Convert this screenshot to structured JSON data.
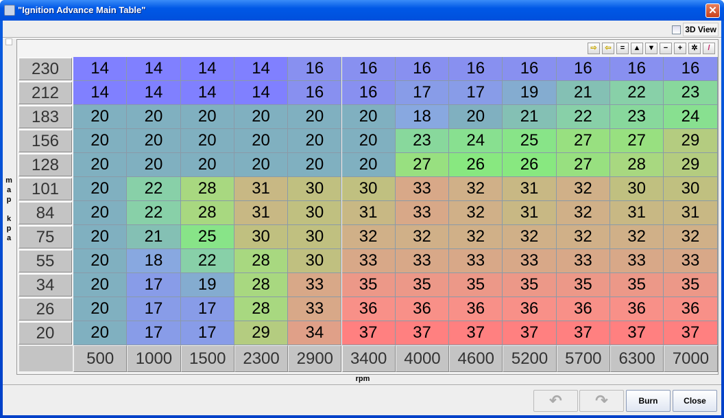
{
  "window": {
    "title": "\"Ignition Advance Main Table\"",
    "close_glyph": "✕"
  },
  "view3d_label": "3D View",
  "toolbar": [
    {
      "name": "shift-right",
      "glyph": "⇨"
    },
    {
      "name": "shift-left",
      "glyph": "⇦"
    },
    {
      "name": "set-equal",
      "glyph": "="
    },
    {
      "name": "increase",
      "glyph": "▲"
    },
    {
      "name": "decrease",
      "glyph": "▼"
    },
    {
      "name": "subtract",
      "glyph": "−"
    },
    {
      "name": "add",
      "glyph": "+"
    },
    {
      "name": "multiply",
      "glyph": "✲"
    },
    {
      "name": "paint",
      "glyph": "/"
    }
  ],
  "y_axis": {
    "label": "m\na\np\n\nk\np\na",
    "values": [
      "230",
      "212",
      "183",
      "156",
      "128",
      "101",
      "84",
      "75",
      "55",
      "34",
      "26",
      "20"
    ]
  },
  "x_axis": {
    "label": "rpm",
    "values": [
      "500",
      "1000",
      "1500",
      "2300",
      "2900",
      "3400",
      "4000",
      "4600",
      "5200",
      "5700",
      "6300",
      "7000"
    ]
  },
  "table": [
    [
      14,
      14,
      14,
      14,
      16,
      16,
      16,
      16,
      16,
      16,
      16,
      16
    ],
    [
      14,
      14,
      14,
      14,
      16,
      16,
      17,
      17,
      19,
      21,
      22,
      23
    ],
    [
      20,
      20,
      20,
      20,
      20,
      20,
      18,
      20,
      21,
      22,
      23,
      24
    ],
    [
      20,
      20,
      20,
      20,
      20,
      20,
      23,
      24,
      25,
      27,
      27,
      29
    ],
    [
      20,
      20,
      20,
      20,
      20,
      20,
      27,
      26,
      26,
      27,
      28,
      29
    ],
    [
      20,
      22,
      28,
      31,
      30,
      30,
      33,
      32,
      31,
      32,
      30,
      30
    ],
    [
      20,
      22,
      28,
      31,
      30,
      31,
      33,
      32,
      31,
      32,
      31,
      31
    ],
    [
      20,
      21,
      25,
      30,
      30,
      32,
      32,
      32,
      32,
      32,
      32,
      32
    ],
    [
      20,
      18,
      22,
      28,
      30,
      33,
      33,
      33,
      33,
      33,
      33,
      33
    ],
    [
      20,
      17,
      19,
      28,
      33,
      35,
      35,
      35,
      35,
      35,
      35,
      35
    ],
    [
      20,
      17,
      17,
      28,
      33,
      36,
      36,
      36,
      36,
      36,
      36,
      36
    ],
    [
      20,
      17,
      17,
      29,
      34,
      37,
      37,
      37,
      37,
      37,
      37,
      37
    ]
  ],
  "color_stops": [
    [
      14,
      "#8080ff"
    ],
    [
      16,
      "#8890f0"
    ],
    [
      18,
      "#88a8e0"
    ],
    [
      20,
      "#80b0c0"
    ],
    [
      22,
      "#88d0a8"
    ],
    [
      24,
      "#88e090"
    ],
    [
      26,
      "#88e880"
    ],
    [
      28,
      "#a8d880"
    ],
    [
      30,
      "#c0c080"
    ],
    [
      32,
      "#d0b088"
    ],
    [
      34,
      "#e0a088"
    ],
    [
      36,
      "#f89088"
    ],
    [
      37,
      "#ff8080"
    ]
  ],
  "buttons": {
    "undo": "↶",
    "redo": "↷",
    "burn": "Burn",
    "close": "Close"
  }
}
